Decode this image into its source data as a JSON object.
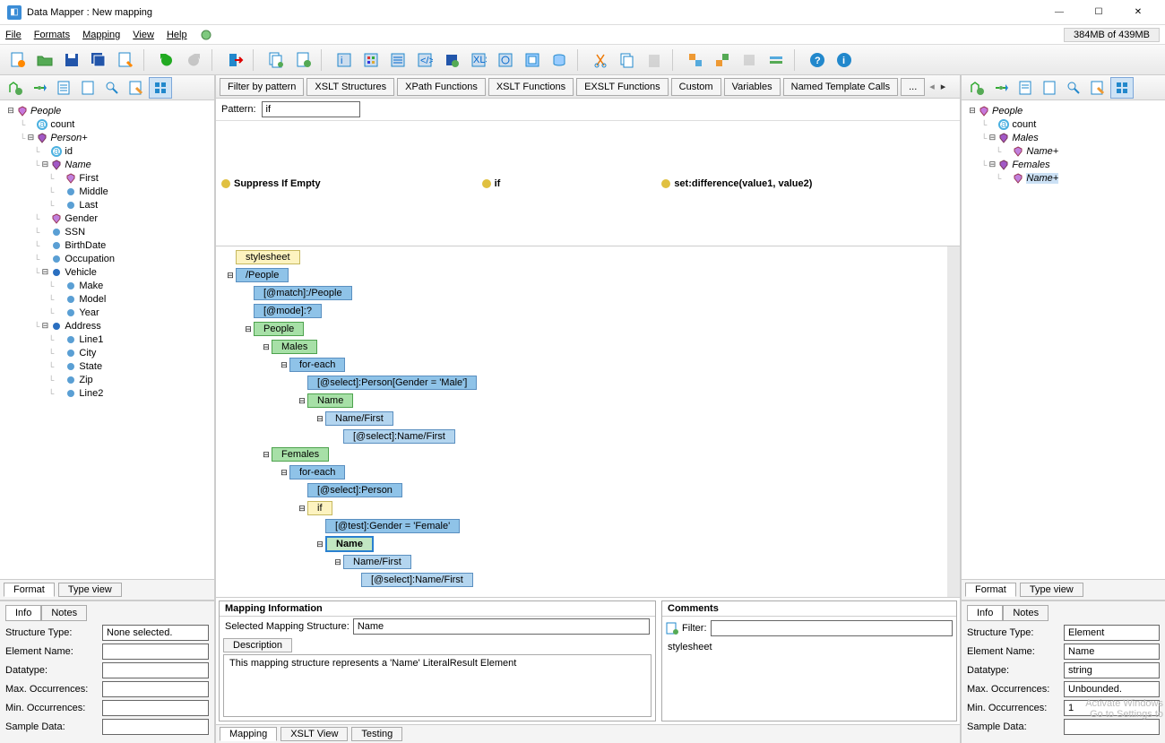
{
  "window": {
    "title": "Data Mapper : New mapping"
  },
  "menu": {
    "file": "File",
    "formats": "Formats",
    "mapping": "Mapping",
    "view": "View",
    "help": "Help",
    "memory": "384MB of 439MB"
  },
  "left_tree": [
    {
      "d": 0,
      "ico": "people",
      "label": "People",
      "exp": "open",
      "italic": true
    },
    {
      "d": 1,
      "ico": "attr",
      "label": "count",
      "exp": ""
    },
    {
      "d": 1,
      "ico": "elem",
      "label": "Person+",
      "exp": "open",
      "italic": true
    },
    {
      "d": 2,
      "ico": "attr",
      "label": "id",
      "exp": ""
    },
    {
      "d": 2,
      "ico": "elem",
      "label": "Name",
      "exp": "open",
      "italic": true
    },
    {
      "d": 3,
      "ico": "elem2",
      "label": "First",
      "exp": ""
    },
    {
      "d": 3,
      "ico": "leaf",
      "label": "Middle",
      "exp": ""
    },
    {
      "d": 3,
      "ico": "leaf",
      "label": "Last",
      "exp": ""
    },
    {
      "d": 2,
      "ico": "elem2",
      "label": "Gender",
      "exp": ""
    },
    {
      "d": 2,
      "ico": "leaf",
      "label": "SSN",
      "exp": ""
    },
    {
      "d": 2,
      "ico": "leaf",
      "label": "BirthDate",
      "exp": ""
    },
    {
      "d": 2,
      "ico": "leaf",
      "label": "Occupation",
      "exp": ""
    },
    {
      "d": 2,
      "ico": "bleaf",
      "label": "Vehicle",
      "exp": "open"
    },
    {
      "d": 3,
      "ico": "leaf",
      "label": "Make",
      "exp": ""
    },
    {
      "d": 3,
      "ico": "leaf",
      "label": "Model",
      "exp": ""
    },
    {
      "d": 3,
      "ico": "leaf",
      "label": "Year",
      "exp": ""
    },
    {
      "d": 2,
      "ico": "bleaf",
      "label": "Address",
      "exp": "open"
    },
    {
      "d": 3,
      "ico": "leaf",
      "label": "Line1",
      "exp": ""
    },
    {
      "d": 3,
      "ico": "leaf",
      "label": "City",
      "exp": ""
    },
    {
      "d": 3,
      "ico": "leaf",
      "label": "State",
      "exp": ""
    },
    {
      "d": 3,
      "ico": "leaf",
      "label": "Zip",
      "exp": ""
    },
    {
      "d": 3,
      "ico": "leaf",
      "label": "Line2",
      "exp": ""
    }
  ],
  "right_tree": [
    {
      "d": 0,
      "ico": "people",
      "label": "People",
      "exp": "open",
      "italic": true
    },
    {
      "d": 1,
      "ico": "attr",
      "label": "count",
      "exp": ""
    },
    {
      "d": 1,
      "ico": "elem",
      "label": "Males",
      "exp": "open",
      "italic": true
    },
    {
      "d": 2,
      "ico": "elem2",
      "label": "Name+",
      "exp": "",
      "italic": true
    },
    {
      "d": 1,
      "ico": "elem",
      "label": "Females",
      "exp": "open",
      "italic": true
    },
    {
      "d": 2,
      "ico": "elem2",
      "label": "Name+",
      "exp": "",
      "italic": true,
      "selected": true
    }
  ],
  "filter": {
    "tabs": [
      "Filter by pattern",
      "XSLT Structures",
      "XPath Functions",
      "XSLT Functions",
      "EXSLT Functions",
      "Custom",
      "Variables",
      "Named Template Calls",
      "..."
    ],
    "pattern_label": "Pattern:",
    "pattern_value": "if",
    "items": [
      "Suppress If Empty",
      "if",
      "set:difference(value1, value2)"
    ]
  },
  "map_tree": [
    {
      "d": 0,
      "cls": "mb-yellow",
      "label": "stylesheet",
      "exp": ""
    },
    {
      "d": 0,
      "cls": "mb-blue",
      "label": "/People",
      "exp": "open"
    },
    {
      "d": 1,
      "cls": "mb-blue",
      "label": "[@match]:/People",
      "exp": ""
    },
    {
      "d": 1,
      "cls": "mb-blue",
      "label": "[@mode]:?",
      "exp": ""
    },
    {
      "d": 1,
      "cls": "mb-green",
      "label": "People",
      "exp": "open"
    },
    {
      "d": 2,
      "cls": "mb-green",
      "label": "Males",
      "exp": "open"
    },
    {
      "d": 3,
      "cls": "mb-blue",
      "label": "for-each",
      "exp": "open"
    },
    {
      "d": 4,
      "cls": "mb-blue",
      "label": "[@select]:Person[Gender = 'Male']",
      "exp": ""
    },
    {
      "d": 4,
      "cls": "mb-green",
      "label": "Name",
      "exp": "open"
    },
    {
      "d": 5,
      "cls": "mb-blue2",
      "label": "Name/First",
      "exp": "open"
    },
    {
      "d": 6,
      "cls": "mb-blue2",
      "label": "[@select]:Name/First",
      "exp": ""
    },
    {
      "d": 2,
      "cls": "mb-green",
      "label": "Females",
      "exp": "open"
    },
    {
      "d": 3,
      "cls": "mb-blue",
      "label": "for-each",
      "exp": "open"
    },
    {
      "d": 4,
      "cls": "mb-blue",
      "label": "[@select]:Person",
      "exp": ""
    },
    {
      "d": 4,
      "cls": "mb-yellow",
      "label": "if",
      "exp": "open"
    },
    {
      "d": 5,
      "cls": "mb-blue",
      "label": "[@test]:Gender = 'Female'",
      "exp": ""
    },
    {
      "d": 5,
      "cls": "mb-sel",
      "label": "Name",
      "exp": "open"
    },
    {
      "d": 6,
      "cls": "mb-blue2",
      "label": "Name/First",
      "exp": "open"
    },
    {
      "d": 7,
      "cls": "mb-blue2",
      "label": "[@select]:Name/First",
      "exp": ""
    }
  ],
  "mapping_info": {
    "header": "Mapping Information",
    "sel_label": "Selected Mapping Structure:",
    "sel_value": "Name",
    "desc_tab": "Description",
    "desc_text": "This mapping structure represents a 'Name' LiteralResult Element"
  },
  "comments": {
    "header": "Comments",
    "filter_label": "Filter:",
    "body": "stylesheet"
  },
  "left_info": {
    "tabs": [
      "Info",
      "Notes"
    ],
    "rows": [
      {
        "label": "Structure Type:",
        "value": "None selected."
      },
      {
        "label": "Element Name:",
        "value": ""
      },
      {
        "label": "Datatype:",
        "value": ""
      },
      {
        "label": "Max. Occurrences:",
        "value": ""
      },
      {
        "label": "Min. Occurrences:",
        "value": ""
      },
      {
        "label": "Sample Data:",
        "value": ""
      }
    ]
  },
  "right_info": {
    "tabs": [
      "Info",
      "Notes"
    ],
    "rows": [
      {
        "label": "Structure Type:",
        "value": "Element"
      },
      {
        "label": "Element Name:",
        "value": "Name"
      },
      {
        "label": "Datatype:",
        "value": "string"
      },
      {
        "label": "Max. Occurrences:",
        "value": "Unbounded."
      },
      {
        "label": "Min. Occurrences:",
        "value": "1"
      },
      {
        "label": "Sample Data:",
        "value": ""
      }
    ]
  },
  "bottom_tabs": {
    "format": "Format",
    "typeview": "Type view",
    "mapping": "Mapping",
    "xsltview": "XSLT View",
    "testing": "Testing"
  },
  "watermark": {
    "line1": "Activate Windows",
    "line2": "Go to Settings to"
  }
}
